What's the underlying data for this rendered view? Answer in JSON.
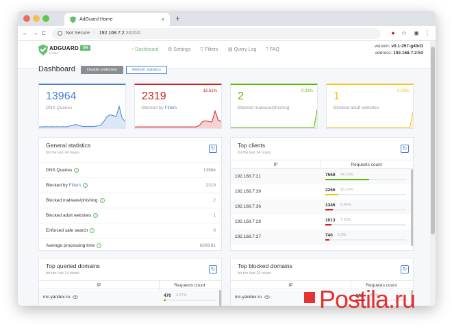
{
  "browser": {
    "tab_title": "AdGuard Home",
    "tab_close": "×",
    "new_tab": "+",
    "back": "←",
    "forward": "→",
    "reload": "C",
    "secure_label": "Not Secure",
    "url_host": "192.168.7.2",
    "url_rest": ":3000/#",
    "colors": {
      "close": "#ed6a5e",
      "min": "#f5bf4f",
      "max": "#61c554"
    }
  },
  "header": {
    "logo_text": "ADGUARD",
    "logo_sub": "HOME",
    "on_badge": "ON",
    "nav": [
      {
        "label": "Dashboard",
        "icon": "dashboard-icon",
        "active": true
      },
      {
        "label": "Settings",
        "icon": "gear-icon"
      },
      {
        "label": "Filters",
        "icon": "filter-icon"
      },
      {
        "label": "Query Log",
        "icon": "document-icon"
      },
      {
        "label": "FAQ",
        "icon": "help-icon"
      }
    ],
    "version_label": "version:",
    "version": "v0.1-257-g40d1",
    "address_label": "address:",
    "address": "192.168.7.2:53"
  },
  "dashboard": {
    "title": "Dashboard",
    "disable_protection": "Disable protection",
    "refresh_statistics": "Refresh statistics"
  },
  "stats": [
    {
      "value": "13964",
      "label": "DNS Queries",
      "percent": "",
      "color": "#467fcf",
      "fill": "#dbe7f7"
    },
    {
      "value": "2319",
      "label_pre": "Blocked by ",
      "label_link": "Filters",
      "percent": "16.61%",
      "color": "#cd201f",
      "fill": "#f6d3d3"
    },
    {
      "value": "2",
      "label": "Blocked malware/phishing",
      "percent": "0.01%",
      "color": "#5eba00",
      "fill": "#e7f4d9"
    },
    {
      "value": "1",
      "label": "Blocked adult websites",
      "percent": "0.01%",
      "color": "#f1c40f",
      "fill": "#fcf3cf"
    }
  ],
  "sparklines": {
    "dns": [
      0.02,
      0.02,
      0.03,
      0.02,
      0.03,
      0.02,
      0.03,
      0.02,
      0.03,
      0.02,
      0.05,
      0.08,
      0.1,
      0.06,
      0.04,
      0.03,
      0.04,
      0.03,
      0.04,
      0.05,
      0.08,
      0.2,
      0.35,
      0.42,
      0.4,
      0.36,
      0.7,
      0.3,
      0.2
    ],
    "filters": [
      0.02,
      0.02,
      0.02,
      0.02,
      0.02,
      0.02,
      0.02,
      0.02,
      0.02,
      0.02,
      0.02,
      0.02,
      0.02,
      0.02,
      0.02,
      0.02,
      0.02,
      0.02,
      0.02,
      0.02,
      0.02,
      0.08,
      0.2,
      0.22,
      0.2,
      0.18,
      0.55,
      0.25,
      0.2
    ],
    "malware": [
      0,
      0,
      0,
      0,
      0,
      0,
      0,
      0,
      0,
      0,
      0,
      0,
      0,
      0,
      0,
      0,
      0,
      0,
      0,
      0,
      0,
      0,
      0,
      0,
      0,
      0,
      0,
      0,
      0.6
    ],
    "adult": [
      0,
      0,
      0,
      0,
      0,
      0,
      0,
      0,
      0,
      0,
      0,
      0,
      0,
      0,
      0,
      0,
      0,
      0,
      0,
      0,
      0,
      0,
      0,
      0,
      0,
      0,
      0,
      0,
      0.5
    ]
  },
  "general": {
    "title": "General statistics",
    "subtitle": "for the last 24 hours",
    "rows": [
      {
        "label": "DNS Queries",
        "value": "13964"
      },
      {
        "label_pre": "Blocked by ",
        "label_link": "Filters",
        "value": "2319"
      },
      {
        "label": "Blocked malware/phishing",
        "value": "2"
      },
      {
        "label": "Blocked adult websites",
        "value": "1"
      },
      {
        "label": "Enforced safe search",
        "value": "0"
      },
      {
        "label": "Average processing time",
        "value": "6309.81"
      }
    ],
    "help_glyph": "?"
  },
  "top_clients": {
    "title": "Top clients",
    "subtitle": "for the last 24 hours",
    "col_ip": "IP",
    "col_req": "Requests count",
    "rows": [
      {
        "ip": "192.168.7.21",
        "count": "7559",
        "percent": "54.13%",
        "ratio": 0.54,
        "color": "#5eba00"
      },
      {
        "ip": "192.168.7.39",
        "count": "2266",
        "percent": "16.23%",
        "ratio": 0.16,
        "color": "#f1c40f"
      },
      {
        "ip": "192.168.7.36",
        "count": "1346",
        "percent": "9.64%",
        "ratio": 0.096,
        "color": "#cd201f"
      },
      {
        "ip": "192.168.7.28",
        "count": "1013",
        "percent": "7.25%",
        "ratio": 0.0725,
        "color": "#cd201f"
      },
      {
        "ip": "192.168.7.37",
        "count": "740",
        "percent": "5.3%",
        "ratio": 0.053,
        "color": "#cd201f"
      }
    ]
  },
  "top_queried": {
    "title": "Top queried domains",
    "subtitle": "for the last 24 hours",
    "col_ip": "IP",
    "col_req": "Requests count",
    "rows": [
      {
        "domain": "mc.yandex.ru",
        "count": "470",
        "percent": "3.37%",
        "ratio": 0.0337,
        "color": "#5eba00"
      }
    ]
  },
  "top_blocked": {
    "title": "Top blocked domains",
    "subtitle": "for the last 24 hours",
    "col_ip": "IP",
    "col_req": "Requests count",
    "rows": [
      {
        "domain": "mc.yandex.ru",
        "count": "443",
        "percent": "19.1%",
        "ratio": 0.19,
        "color": "#cd201f"
      }
    ]
  },
  "watermark": "Postila.ru"
}
